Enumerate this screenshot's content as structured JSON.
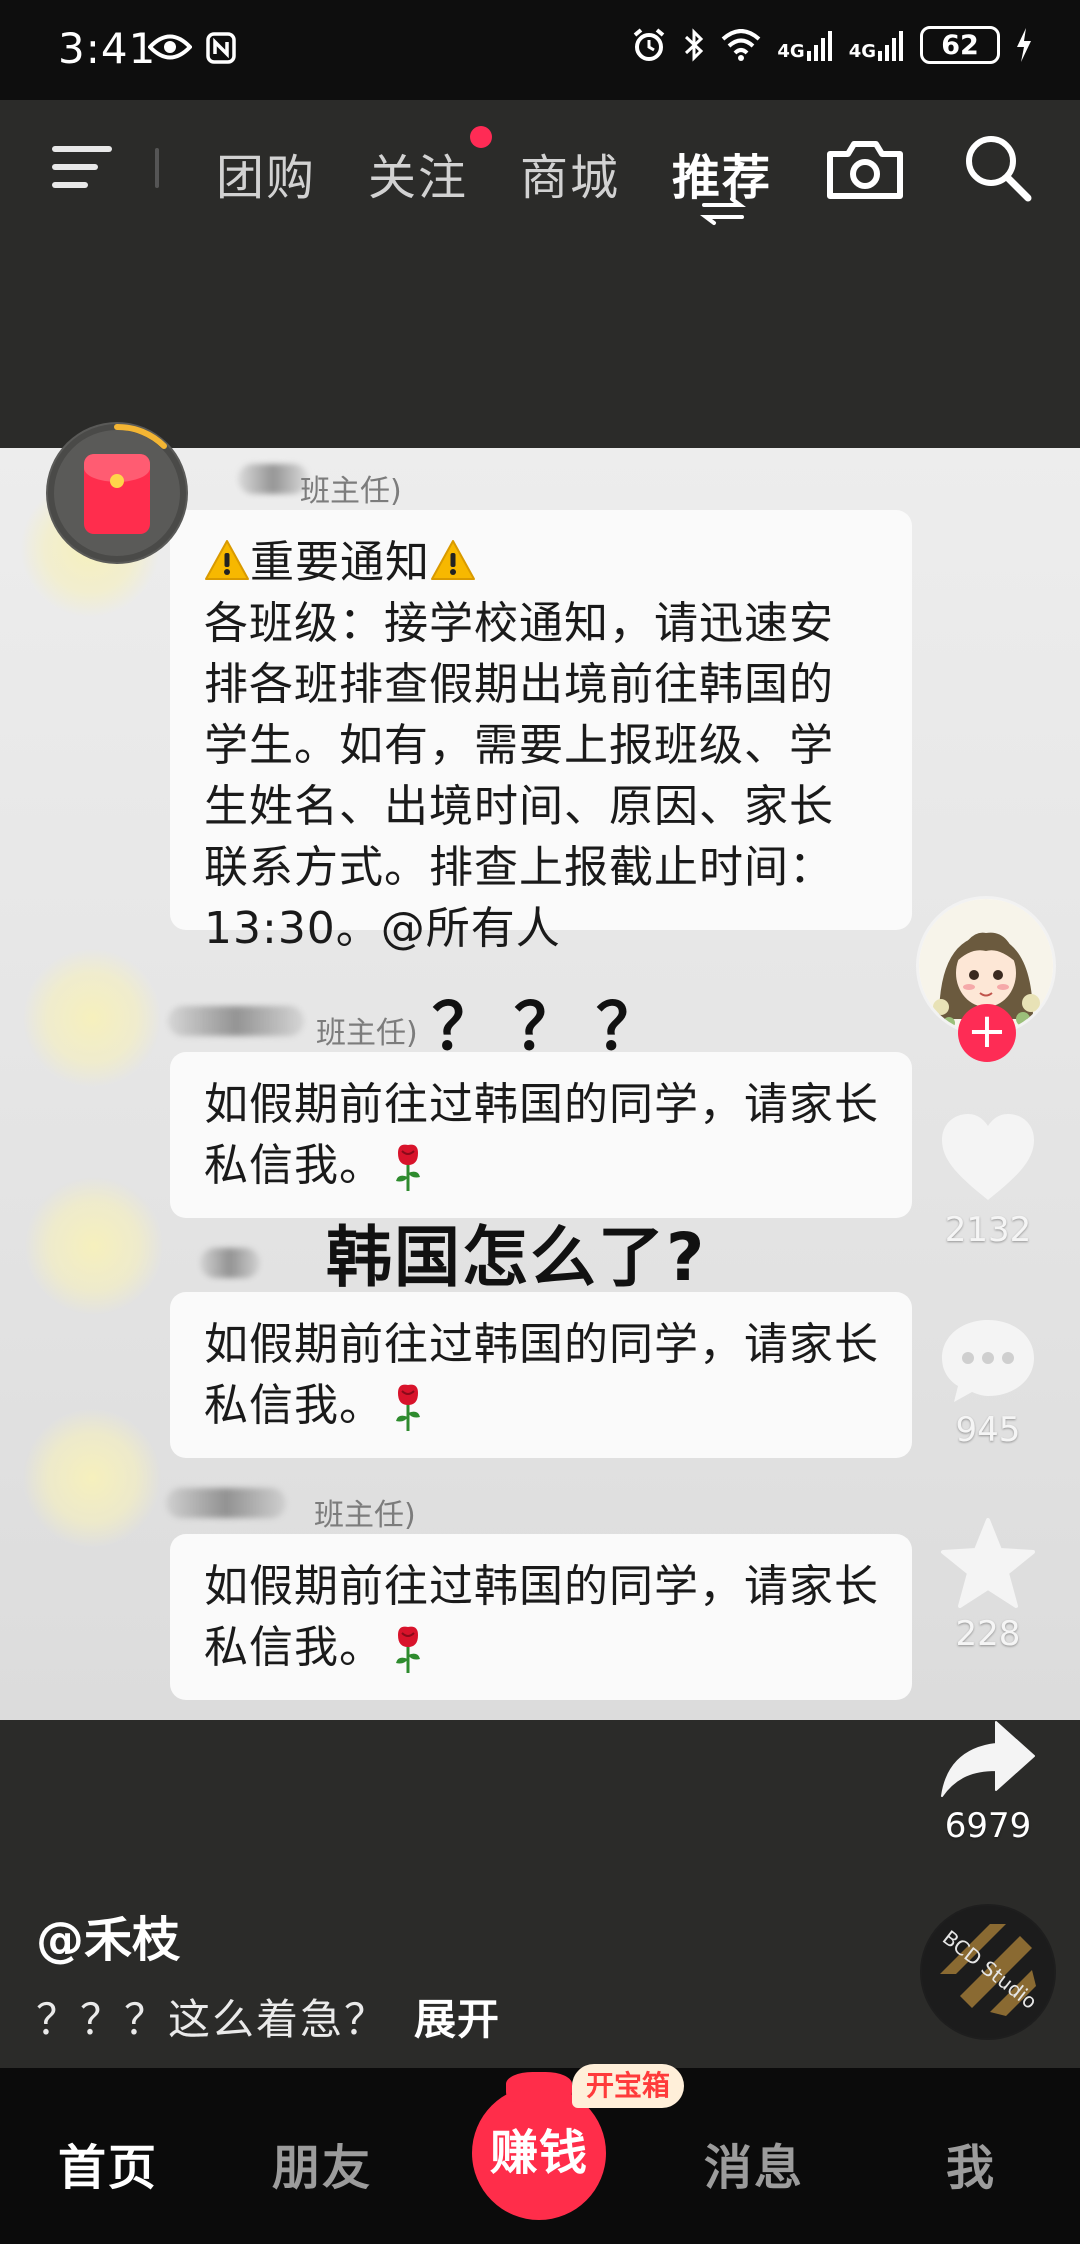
{
  "status_bar": {
    "time": "3:41",
    "network_1": "4G",
    "network_2": "4G",
    "battery": "62"
  },
  "top_nav": {
    "tabs": [
      {
        "label": "团购",
        "active": false
      },
      {
        "label": "关注",
        "active": false,
        "has_dot": true
      },
      {
        "label": "商城",
        "active": false
      },
      {
        "label": "推荐",
        "active": true
      }
    ],
    "accent": "#ff2b55"
  },
  "video": {
    "messages": [
      {
        "sender": "班主任)",
        "title": "重要通知",
        "lines": [
          "各班级：接学校通知，请迅速安",
          "排各班排查假期出境前往韩国的",
          "学生。如有，需要上报班级、学",
          "生姓名、出境时间、原因、家长",
          "联系方式。排查上报截止时间：",
          "13:30。@所有人"
        ]
      },
      {
        "sender": "班主任)",
        "lines": [
          "如假期前往过韩国的同学，请家长",
          "私信我。"
        ]
      },
      {
        "sender": "",
        "lines": [
          "如假期前往过韩国的同学，请家长",
          "私信我。"
        ]
      },
      {
        "sender": "班主任)",
        "lines": [
          "如假期前往过韩国的同学，请家长",
          "私信我。"
        ]
      }
    ],
    "overlay_question": "？？？",
    "overlay_caption": "韩国怎么了?"
  },
  "actions": {
    "likes": "2132",
    "comments": "945",
    "favorites": "228",
    "shares": "6979"
  },
  "post": {
    "author": "@禾枝",
    "description": "？？？这么着急？",
    "expand_label": "展开"
  },
  "bottom_nav": {
    "home": "首页",
    "friends": "朋友",
    "earn": "赚钱",
    "treasure": "开宝箱",
    "messages": "消息",
    "me": "我"
  },
  "colors": {
    "brand_red": "#fe2c55",
    "earn_red": "#ff2d4a"
  },
  "icons": [
    "menu-icon",
    "camera-icon",
    "search-icon",
    "heart-icon",
    "comment-icon",
    "star-icon",
    "share-icon",
    "warning-icon",
    "rose-icon",
    "red-envelope-icon"
  ]
}
